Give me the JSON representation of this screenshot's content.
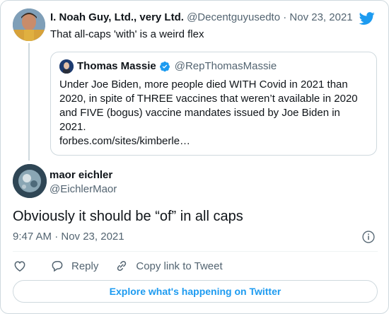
{
  "parent_tweet": {
    "name": "I. Noah Guy, Ltd., very Ltd.",
    "handle": "@Decentguyusedto",
    "separator": "·",
    "date": "Nov 23, 2021",
    "text": "That all-caps 'with' is a weird flex"
  },
  "quoted_tweet": {
    "name": "Thomas Massie",
    "handle": "@RepThomasMassie",
    "verified": true,
    "text_lines": [
      "Under Joe Biden, more people died WITH Covid in 2021 than",
      "2020, in spite of THREE vaccines that weren’t available in 2020",
      "and FIVE (bogus) vaccine mandates issued by Joe Biden in",
      "2021."
    ],
    "link": "forbes.com/sites/kimberle…"
  },
  "main_tweet": {
    "name": "maor eichler",
    "handle": "@EichlerMaor",
    "text": "Obviously it should be “of” in all caps",
    "timestamp": "9:47 AM · Nov 23, 2021"
  },
  "actions": {
    "reply_label": "Reply",
    "copy_link_label": "Copy link to Tweet"
  },
  "explore_label": "Explore what's happening on Twitter",
  "icons": {
    "brand": "twitter-bird-icon",
    "verified": "verified-badge-icon",
    "info": "info-icon",
    "like": "heart-icon",
    "reply": "reply-bubble-icon",
    "copy_link": "link-icon"
  },
  "colors": {
    "brand_blue": "#1d9bf0",
    "text": "#0f1419",
    "secondary_text": "#536471",
    "border": "#cfd9de"
  }
}
